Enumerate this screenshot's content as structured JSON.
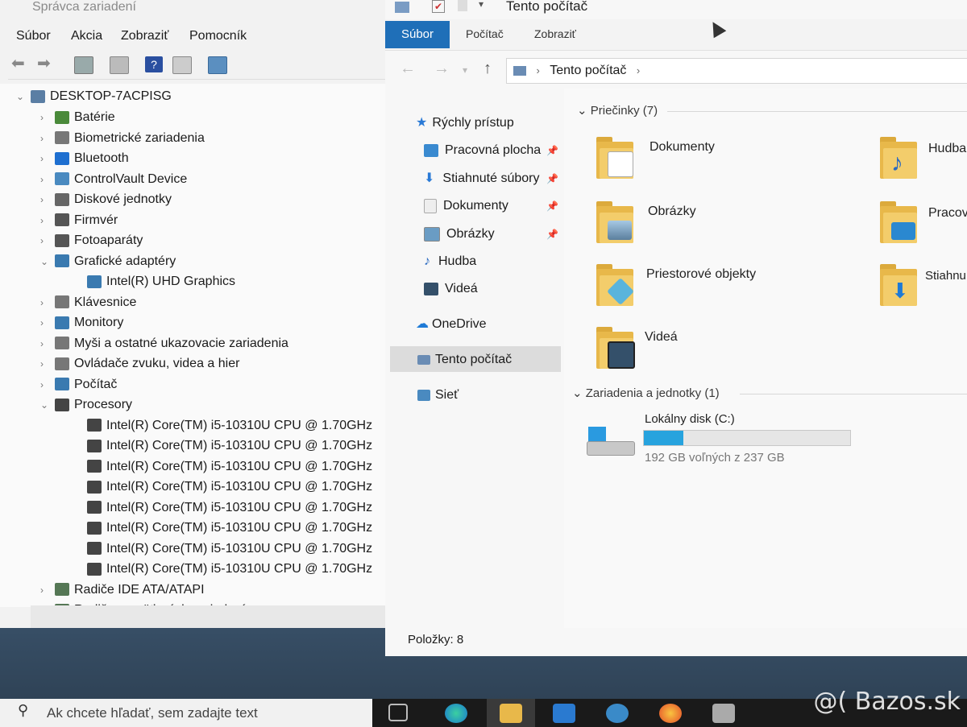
{
  "device_manager": {
    "title": "Správca zariadení",
    "menu": [
      "Súbor",
      "Akcia",
      "Zobraziť",
      "Pomocník"
    ],
    "root": "DESKTOP-7ACPISG",
    "tree": [
      {
        "label": "Batérie",
        "expanded": false,
        "color": "#4a8a3a"
      },
      {
        "label": "Biometrické zariadenia",
        "expanded": false,
        "color": "#777777"
      },
      {
        "label": "Bluetooth",
        "expanded": false,
        "color": "#1e6fd0"
      },
      {
        "label": "ControlVault Device",
        "expanded": false,
        "color": "#4a8ac0"
      },
      {
        "label": "Diskové jednotky",
        "expanded": false,
        "color": "#666666"
      },
      {
        "label": "Firmvér",
        "expanded": false,
        "color": "#555555"
      },
      {
        "label": "Fotoaparáty",
        "expanded": false,
        "color": "#555555"
      },
      {
        "label": "Grafické adaptéry",
        "expanded": true,
        "color": "#3a7ab0"
      },
      {
        "label": "Intel(R) UHD Graphics",
        "child": true,
        "color": "#3a7ab0"
      },
      {
        "label": "Klávesnice",
        "expanded": false,
        "color": "#777777"
      },
      {
        "label": "Monitory",
        "expanded": false,
        "color": "#3a7ab0"
      },
      {
        "label": "Myši a ostatné ukazovacie zariadenia",
        "expanded": false,
        "color": "#777777"
      },
      {
        "label": "Ovládače zvuku, videa a hier",
        "expanded": false,
        "color": "#777777"
      },
      {
        "label": "Počítač",
        "expanded": false,
        "color": "#3a7ab0"
      },
      {
        "label": "Procesory",
        "expanded": true,
        "color": "#444444"
      },
      {
        "label": "Intel(R) Core(TM) i5-10310U CPU @ 1.70GHz",
        "child": true,
        "color": "#444444"
      },
      {
        "label": "Intel(R) Core(TM) i5-10310U CPU @ 1.70GHz",
        "child": true,
        "color": "#444444"
      },
      {
        "label": "Intel(R) Core(TM) i5-10310U CPU @ 1.70GHz",
        "child": true,
        "color": "#444444"
      },
      {
        "label": "Intel(R) Core(TM) i5-10310U CPU @ 1.70GHz",
        "child": true,
        "color": "#444444"
      },
      {
        "label": "Intel(R) Core(TM) i5-10310U CPU @ 1.70GHz",
        "child": true,
        "color": "#444444"
      },
      {
        "label": "Intel(R) Core(TM) i5-10310U CPU @ 1.70GHz",
        "child": true,
        "color": "#444444"
      },
      {
        "label": "Intel(R) Core(TM) i5-10310U CPU @ 1.70GHz",
        "child": true,
        "color": "#444444"
      },
      {
        "label": "Intel(R) Core(TM) i5-10310U CPU @ 1.70GHz",
        "child": true,
        "color": "#444444"
      },
      {
        "label": "Radiče IDE ATA/ATAPI",
        "expanded": false,
        "color": "#557755"
      },
      {
        "label": "Radiče pamäťových zariadení",
        "expanded": false,
        "color": "#557755"
      }
    ]
  },
  "explorer": {
    "title": "Tento počítač",
    "tabs": {
      "file": "Súbor",
      "computer": "Počítač",
      "view": "Zobraziť"
    },
    "breadcrumb": "Tento počítač",
    "nav": {
      "quick_access": "Rýchly prístup",
      "desktop": "Pracovná plocha",
      "downloads": "Stiahnuté súbory",
      "documents": "Dokumenty",
      "pictures": "Obrázky",
      "music": "Hudba",
      "videos": "Videá",
      "onedrive": "OneDrive",
      "this_pc": "Tento počítač",
      "network": "Sieť"
    },
    "folders_header": "Priečinky (7)",
    "folders": {
      "documents": "Dokumenty",
      "music": "Hudba",
      "pictures": "Obrázky",
      "desktop": "Pracov",
      "objects3d": "Priestorové objekty",
      "downloads": "Stiahnu",
      "videos": "Videá"
    },
    "devices_header": "Zariadenia a jednotky (1)",
    "drive": {
      "name": "Lokálny disk (C:)",
      "free_text": "192 GB voľných z 237 GB",
      "used_fraction": 0.19
    },
    "status": "Položky: 8"
  },
  "taskbar": {
    "search_placeholder": "Ak chcete hľadať, sem zadajte text"
  },
  "watermark": "@( Bazos.sk",
  "colors": {
    "accent": "#1f6fb8",
    "drive_fill": "#27a3de",
    "folder": "#f3cd6b"
  }
}
